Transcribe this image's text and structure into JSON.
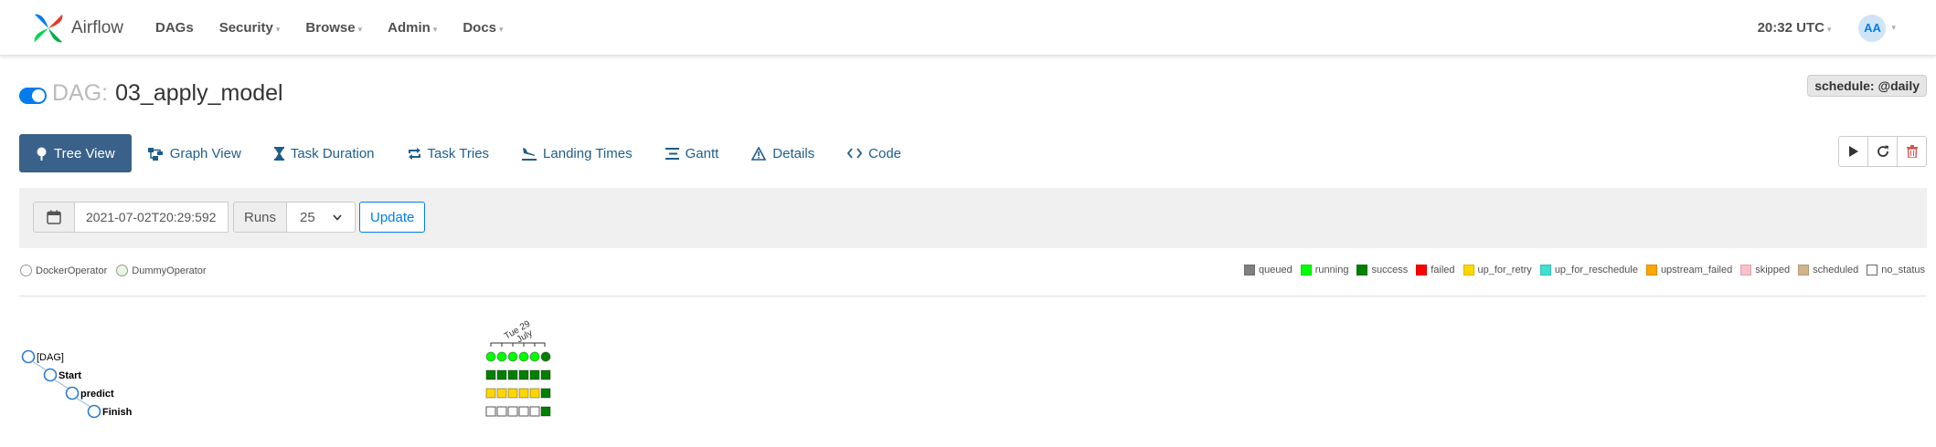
{
  "navbar": {
    "brand": "Airflow",
    "menu": [
      {
        "label": "DAGs",
        "caret": false
      },
      {
        "label": "Security",
        "caret": true
      },
      {
        "label": "Browse",
        "caret": true
      },
      {
        "label": "Admin",
        "caret": true
      },
      {
        "label": "Docs",
        "caret": true
      }
    ],
    "time": "20:32 UTC",
    "user_initials": "AA"
  },
  "dag": {
    "prefix": "DAG:",
    "name": "03_apply_model",
    "paused": false,
    "schedule": "schedule: @daily"
  },
  "tabs": [
    {
      "label": "Tree View",
      "icon": "tree-icon",
      "active": true
    },
    {
      "label": "Graph View",
      "icon": "graph-icon",
      "active": false
    },
    {
      "label": "Task Duration",
      "icon": "hourglass-icon",
      "active": false
    },
    {
      "label": "Task Tries",
      "icon": "repeat-icon",
      "active": false
    },
    {
      "label": "Landing Times",
      "icon": "plane-landing-icon",
      "active": false
    },
    {
      "label": "Gantt",
      "icon": "gantt-icon",
      "active": false
    },
    {
      "label": "Details",
      "icon": "warning-triangle-icon",
      "active": false
    },
    {
      "label": "Code",
      "icon": "code-icon",
      "active": false
    }
  ],
  "actions": [
    {
      "icon": "play-icon",
      "color": "#333333"
    },
    {
      "icon": "refresh-icon",
      "color": "#333333"
    },
    {
      "icon": "trash-icon",
      "color": "#d9534f"
    }
  ],
  "filter": {
    "base_date": "2021-07-02T20:29:592",
    "runs_label": "Runs",
    "runs_value": "25",
    "update_label": "Update"
  },
  "operators": [
    {
      "label": "DockerOperator",
      "color": "#ffffff"
    },
    {
      "label": "DummyOperator",
      "color": "#e8f7e4"
    }
  ],
  "states": [
    {
      "label": "queued",
      "color": "#808080"
    },
    {
      "label": "running",
      "color": "#00ff00"
    },
    {
      "label": "success",
      "color": "#008000"
    },
    {
      "label": "failed",
      "color": "#ff0000"
    },
    {
      "label": "up_for_retry",
      "color": "#ffd700"
    },
    {
      "label": "up_for_reschedule",
      "color": "#40e0d0"
    },
    {
      "label": "upstream_failed",
      "color": "#ffa500"
    },
    {
      "label": "skipped",
      "color": "#ffc0cb"
    },
    {
      "label": "scheduled",
      "color": "#d2b48c"
    },
    {
      "label": "no_status",
      "color": "#ffffff"
    }
  ],
  "tree": {
    "date_label_1": "Tue 29",
    "date_label_2": "July",
    "tasks": [
      {
        "label": "[DAG]",
        "depth": 0,
        "runs": [
          "running",
          "running",
          "running",
          "running",
          "running",
          "success"
        ]
      },
      {
        "label": "Start",
        "depth": 1,
        "runs": [
          "success",
          "success",
          "success",
          "success",
          "success",
          "success"
        ]
      },
      {
        "label": "predict",
        "depth": 2,
        "runs": [
          "up_for_retry",
          "up_for_retry",
          "up_for_retry",
          "up_for_retry",
          "up_for_retry",
          "success"
        ]
      },
      {
        "label": "Finish",
        "depth": 3,
        "runs": [
          "no_status",
          "no_status",
          "no_status",
          "no_status",
          "no_status",
          "success"
        ]
      }
    ]
  }
}
